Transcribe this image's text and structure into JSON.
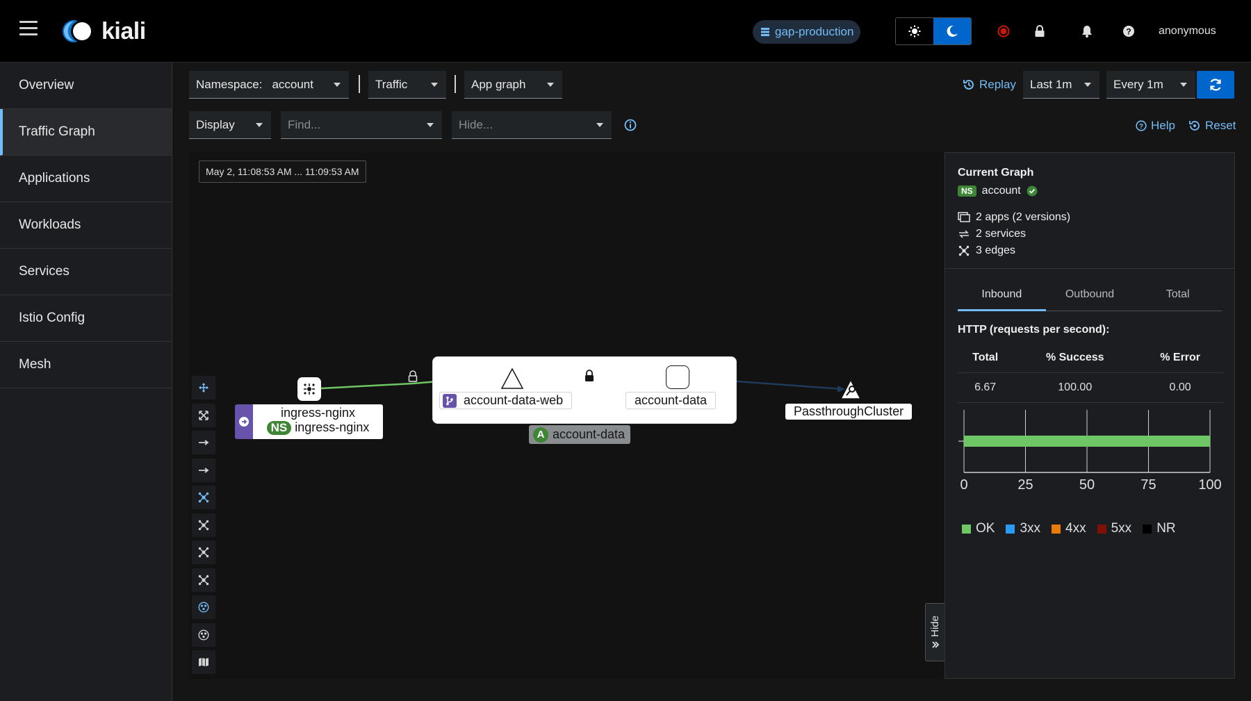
{
  "masthead": {
    "brand": "kiali",
    "cluster": "gap-production",
    "user": "anonymous"
  },
  "sidebar": {
    "items": [
      {
        "label": "Overview"
      },
      {
        "label": "Traffic Graph",
        "active": true
      },
      {
        "label": "Applications"
      },
      {
        "label": "Workloads"
      },
      {
        "label": "Services"
      },
      {
        "label": "Istio Config"
      },
      {
        "label": "Mesh"
      }
    ]
  },
  "toolbar": {
    "namespace_label": "Namespace:",
    "namespace_value": "account",
    "traffic": "Traffic",
    "graph_type": "App graph",
    "replay": "Replay",
    "duration": "Last 1m",
    "refresh_interval": "Every 1m",
    "display": "Display",
    "find_placeholder": "Find...",
    "hide_placeholder": "Hide...",
    "help": "Help",
    "reset": "Reset"
  },
  "graph": {
    "time_range": "May 2, 11:08:53 AM ... 11:09:53 AM",
    "nodes": {
      "ingress_name": "ingress-nginx",
      "ingress_ns_badge": "NS",
      "ingress_ns": "ingress-nginx",
      "web": "account-data-web",
      "data": "account-data",
      "app_badge": "A",
      "app_group": "account-data",
      "passthrough": "PassthroughCluster"
    },
    "hide_label": "Hide"
  },
  "side_panel": {
    "title": "Current Graph",
    "ns_badge": "NS",
    "namespace": "account",
    "apps": "2 apps (2 versions)",
    "services": "2 services",
    "edges": "3 edges",
    "tabs": [
      "Inbound",
      "Outbound",
      "Total"
    ],
    "http_title": "HTTP (requests per second):",
    "table_headers": [
      "Total",
      "% Success",
      "% Error"
    ],
    "table_values": [
      "6.67",
      "100.00",
      "0.00"
    ]
  },
  "chart_data": {
    "type": "bar",
    "orientation": "horizontal",
    "categories": [
      ""
    ],
    "series": [
      {
        "name": "OK",
        "values": [
          100
        ],
        "color": "#6ec664"
      },
      {
        "name": "3xx",
        "values": [
          0
        ],
        "color": "#2b9af3"
      },
      {
        "name": "4xx",
        "values": [
          0
        ],
        "color": "#ec7a08"
      },
      {
        "name": "5xx",
        "values": [
          0
        ],
        "color": "#7d1007"
      },
      {
        "name": "NR",
        "values": [
          0
        ],
        "color": "#000000"
      }
    ],
    "xlim": [
      0,
      100
    ],
    "xticks": [
      "0",
      "25",
      "50",
      "75",
      "100"
    ],
    "legend_position": "bottom"
  },
  "colors": {
    "accent": "#73bcf7",
    "primary": "#0066cc",
    "ok": "#6ec664",
    "edge_secure": "#6ec664",
    "edge_passthrough": "#1f3a5a",
    "ns_badge": "#3e8635",
    "ingress_accent": "#6753ac"
  }
}
